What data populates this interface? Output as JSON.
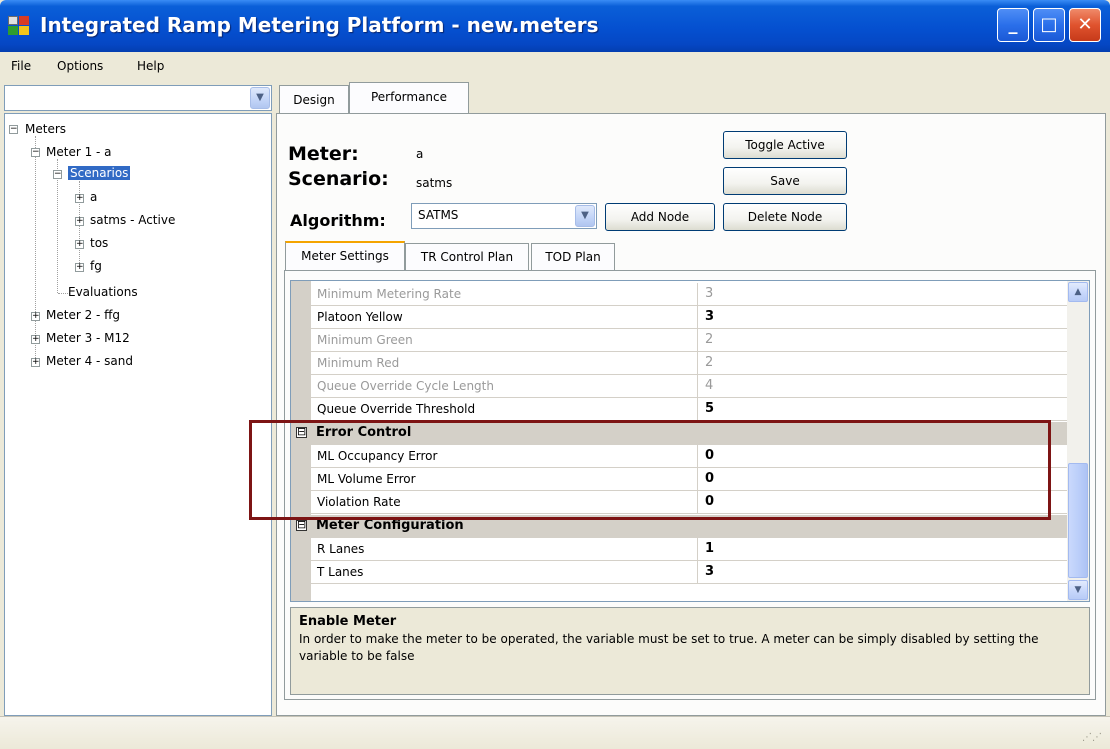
{
  "window": {
    "title": "Integrated Ramp Metering Platform - new.meters",
    "icon": "app-icon",
    "controls": {
      "minimize": "_",
      "maximize": "□",
      "close": "✕"
    }
  },
  "menu": [
    "File",
    "Options",
    "Help"
  ],
  "tree": {
    "root": "Meters",
    "meter1": "Meter 1 - a",
    "scenarios": "Scenarios",
    "scenario_a": "a",
    "scenario_satms": "satms - Active",
    "scenario_tos": "tos",
    "scenario_fg": "fg",
    "evaluations": "Evaluations",
    "meter2": "Meter 2 - ffg",
    "meter3": "Meter 3 - M12",
    "meter4": "Meter 4 - sand"
  },
  "tabs": {
    "design": "Design",
    "performance": "Performance"
  },
  "design": {
    "meter_label": "Meter:",
    "meter_value": "a",
    "scenario_label": "Scenario:",
    "scenario_value": "satms",
    "algorithm_label": "Algorithm:",
    "algorithm_value": "SATMS",
    "buttons": {
      "toggle_active": "Toggle Active",
      "save": "Save",
      "add_node": "Add Node",
      "delete_node": "Delete Node"
    }
  },
  "inner_tabs": {
    "meter_settings": "Meter Settings",
    "tr_control_plan": "TR Control Plan",
    "tod_plan": "TOD Plan"
  },
  "grid": {
    "rows": [
      {
        "name": "Minimum Metering Rate",
        "value": "3"
      },
      {
        "name": "Platoon Yellow",
        "value": "3"
      },
      {
        "name": "Minimum Green",
        "value": "2"
      },
      {
        "name": "Minimum Red",
        "value": "2"
      },
      {
        "name": "Queue Override Cycle Length",
        "value": "4"
      },
      {
        "name": "Queue Override Threshold",
        "value": "5"
      }
    ],
    "error_control": {
      "title": "Error Control",
      "toggle": "⊟",
      "rows": [
        {
          "name": "ML Occupancy Error",
          "value": "0"
        },
        {
          "name": "ML Volume Error",
          "value": "0"
        },
        {
          "name": "Violation Rate",
          "value": "0"
        }
      ]
    },
    "meter_configuration": {
      "title": "Meter Configuration",
      "toggle": "⊟",
      "rows": [
        {
          "name": "R Lanes",
          "value": "1"
        },
        {
          "name": "T Lanes",
          "value": "3"
        }
      ]
    }
  },
  "description": {
    "title": "Enable Meter",
    "text": "In order to make the meter to be operated, the variable must be set to true. A meter can be simply disabled by setting the variable to be false"
  },
  "colors": {
    "titlebar": "#0550d0",
    "selection": "#316ac5",
    "highlight": "#7d1414"
  }
}
